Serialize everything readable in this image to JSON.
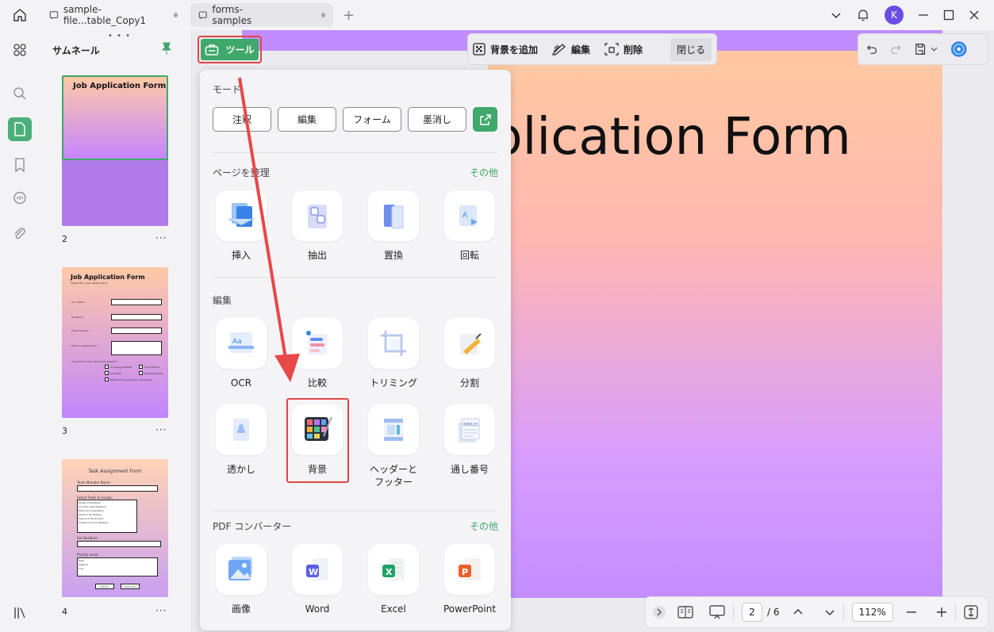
{
  "tabs": [
    {
      "label": "sample-file...table_Copy1"
    },
    {
      "label": "forms-samples"
    }
  ],
  "user": {
    "initial": "K"
  },
  "thumbnail_panel": {
    "title": "サムネール",
    "pages": [
      {
        "number": "2",
        "title": "Job Application Form"
      },
      {
        "number": "3",
        "title": "Job Application Form",
        "subtitle": "Please fill in your details below",
        "fields": [
          "Your Name:",
          "Job Name:",
          "Email Address:",
          "Position Applying For:"
        ],
        "question": "How Did You Hear About This Position?",
        "options": [
          "Company Website",
          "Social Media",
          "Job Board",
          "Print Newsletter",
          "Referral from a Friend or Employee"
        ]
      },
      {
        "number": "4",
        "title": "Task Assignment Form",
        "labels": [
          "Team Member Name:",
          "Select Tasks to Assign:",
          "Set Deadline:",
          "Priority Level:"
        ],
        "tasks": [
          "Design Homepage",
          "Conduct User Research",
          "Write Documentation",
          "Perform QA Testing",
          "Deploy to Production",
          "Prepare Go-Live Meeting"
        ],
        "priorities": [
          "High",
          "Medium",
          "Low"
        ],
        "buttons": [
          "Submit",
          "Clear Form"
        ]
      }
    ]
  },
  "toolbar": {
    "tools_label": "ツール",
    "add_background": "背景を追加",
    "edit": "編集",
    "delete": "削除",
    "close": "閉じる"
  },
  "document": {
    "title_fragment": "plication Form"
  },
  "dropdown": {
    "mode_title": "モード",
    "modes": [
      "注釈",
      "編集",
      "フォーム",
      "墨消し"
    ],
    "page_section": {
      "title": "ページを整理",
      "more": "その他",
      "items": [
        "挿入",
        "抽出",
        "置換",
        "回転"
      ]
    },
    "edit_section": {
      "title": "編集",
      "items": [
        "OCR",
        "比較",
        "トリミング",
        "分割",
        "透かし",
        "背景",
        "ヘッダーと\nフッター",
        "通し番号"
      ]
    },
    "converter_section": {
      "title": "PDF コンバーター",
      "more": "その他",
      "items": [
        "画像",
        "Word",
        "Excel",
        "PowerPoint"
      ]
    }
  },
  "bottombar": {
    "current_page": "2",
    "total_pages": "/ 6",
    "zoom": "112%"
  },
  "colors": {
    "accent": "#3fa86a",
    "annotation_red": "#e04545",
    "page_purple": "#c18cff"
  }
}
